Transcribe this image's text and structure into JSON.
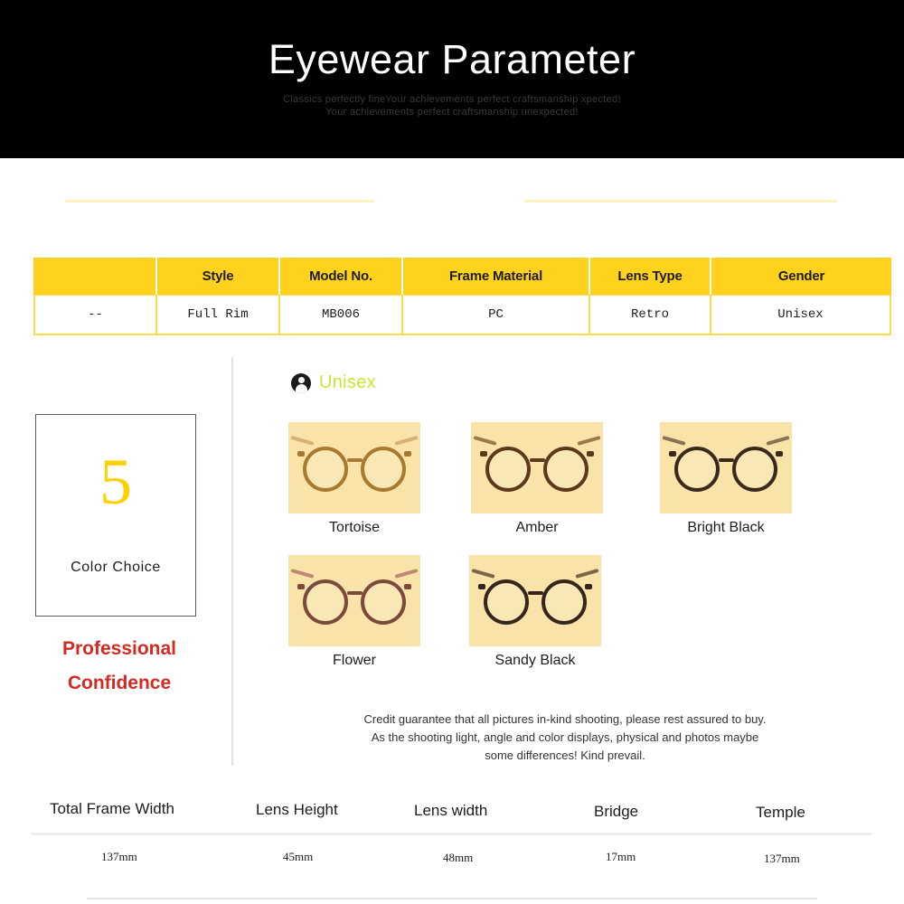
{
  "hero": {
    "title": "Eyewear Parameter",
    "subtitle_line1": "Classics perfectly fineYour  achievements perfect craftsmanship xpected!",
    "subtitle_line2": "Your achievements perfect craftsmanship unexpected!"
  },
  "spec_table": {
    "headers": [
      "",
      "Style",
      "Model No.",
      "Frame Material",
      "Lens Type",
      "Gender"
    ],
    "values": [
      "--",
      "Full Rim",
      "MB006",
      "PC",
      "Retro",
      "Unisex"
    ]
  },
  "color_panel": {
    "count": "5",
    "label": "Color Choice",
    "tagline_line1": "Professional",
    "tagline_line2": "Confidence"
  },
  "gender_marker": {
    "icon": "person-icon",
    "label": "Unisex",
    "color": "#c8e831"
  },
  "colors": [
    {
      "name": "Tortoise",
      "frame_hex": "#a9792f",
      "temple_hex": "#d9b071"
    },
    {
      "name": "Amber",
      "frame_hex": "#5b3a1c",
      "temple_hex": "#9c7a46"
    },
    {
      "name": "Bright Black",
      "frame_hex": "#3b2a1c",
      "temple_hex": "#8a7352"
    },
    {
      "name": "Flower",
      "frame_hex": "#7a4a3c",
      "temple_hex": "#c08a72"
    },
    {
      "name": "Sandy Black",
      "frame_hex": "#35251a",
      "temple_hex": "#7d6647"
    }
  ],
  "swatch_background": "#fae3a8",
  "disclaimer": {
    "line1": "Credit guarantee that all pictures in-kind shooting, please rest assured to buy.",
    "line2": "As the shooting light, angle and color displays, physical and photos maybe",
    "line3": "some differences! Kind prevail."
  },
  "measurements": [
    {
      "label": "Total Frame Width",
      "value": "137mm"
    },
    {
      "label": "Lens Height",
      "value": "45mm"
    },
    {
      "label": "Lens width",
      "value": "48mm"
    },
    {
      "label": "Bridge",
      "value": "17mm"
    },
    {
      "label": "Temple",
      "value": "137mm"
    }
  ],
  "theme": {
    "header_yellow": "#ffd21e",
    "accent_red": "#d42a22",
    "count_yellow": "#ffd100"
  }
}
